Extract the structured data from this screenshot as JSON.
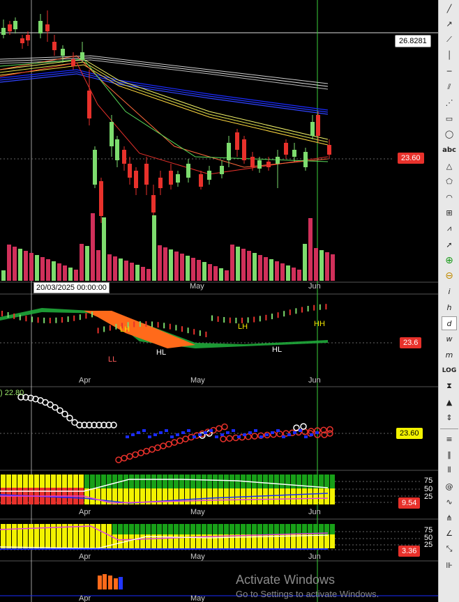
{
  "chart": {
    "crosshair_price_label": "26.8281",
    "crosshair_date_label": "20/03/2025 00:00:00",
    "price_tag_main": "23.60",
    "price_tag_panel2": "23.6",
    "price_tag_panel3": "23.60",
    "price_tag_panel4": "9.54",
    "price_tag_panel5": "3.36",
    "panel3_indicator_label": ") 22.80",
    "scale_labels": [
      "75",
      "50",
      "25"
    ],
    "month_labels": {
      "may": "May",
      "jun": "Jun",
      "apr": "Apr"
    },
    "annotations": {
      "lh1": "LH",
      "ll": "LL",
      "hl1": "HL",
      "lh2": "LH",
      "hl2": "HL",
      "hh": "HH"
    },
    "colors": {
      "up": "#7ddc6e",
      "down": "#e8312b",
      "price_tag_red": "#e8312b",
      "price_tag_yellow": "#f2f200"
    }
  },
  "watermark": {
    "title": "Activate Windows",
    "subtitle": "Go to Settings to activate Windows."
  },
  "toolbar": {
    "text_tool": "abc",
    "log_label": "LOG",
    "tools": [
      "line-icon",
      "ray-icon",
      "extended-line-icon",
      "vertical-line-icon",
      "horizontal-line-icon",
      "parallel-channel-icon",
      "fan-icon",
      "rectangle-icon",
      "ellipse-icon",
      "text-icon",
      "triangle-icon",
      "polygon-icon",
      "arc-icon",
      "fib-icon",
      "zigzag-icon",
      "pointer-icon",
      "zoom-in-icon",
      "zoom-out-icon",
      "info-icon",
      "hour-icon",
      "day-icon",
      "week-icon",
      "month-icon",
      "log-icon",
      "fit-icon",
      "up-icon",
      "down-up-icon",
      "sep",
      "hlines-icon",
      "bars-icon",
      "candles-icon",
      "spiral-icon",
      "wave-icon",
      "pitchfork-icon",
      "angle-icon",
      "measure-icon",
      "bar-count-icon"
    ],
    "letters": {
      "i": "i",
      "h": "h",
      "d": "d",
      "w": "w",
      "m": "m"
    }
  }
}
